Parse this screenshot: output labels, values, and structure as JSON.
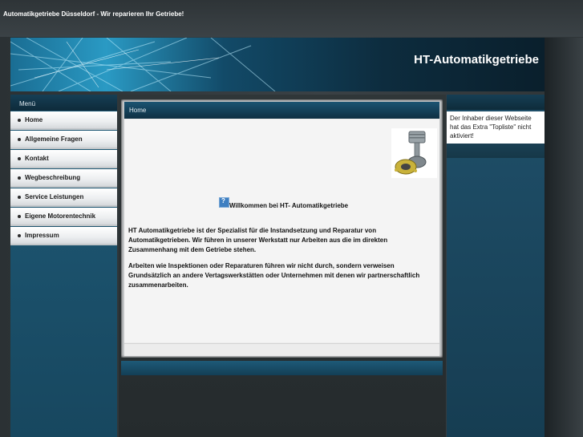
{
  "site": {
    "title": "Automatikgetriebe Düsseldorf - Wir reparieren Ihr Getriebe!"
  },
  "banner": {
    "title": "HT-Automatikgetriebe"
  },
  "menu": {
    "heading": "Menü",
    "items": [
      {
        "label": "Home"
      },
      {
        "label": "Allgemeine Fragen"
      },
      {
        "label": "Kontakt"
      },
      {
        "label": "Wegbeschreibung"
      },
      {
        "label": "Service Leistungen"
      },
      {
        "label": "Eigene Motorentechnik"
      },
      {
        "label": "Impressum"
      }
    ]
  },
  "content": {
    "heading": "Home",
    "welcome": "Willkommen bei HT- Automatikgetriebe",
    "paragraph1": [
      "HT Automatikgetriebe ist der Spezialist für die Instandsetzung und Reparatur von",
      "Automatikgetrieben. Wir führen in unserer Werkstatt nur Arbeiten aus die im direkten",
      "Zusammenhang mit dem Getriebe stehen."
    ],
    "paragraph2": [
      "Arbeiten wie Inspektionen oder Reparaturen führen wir nicht durch, sondern verweisen",
      "Grundsätzlich an andere Vertagswerkstätten oder Unternehmen mit denen wir partnerschaftlich",
      "zusammenarbeiten."
    ]
  },
  "sidebar_right": {
    "notice": "Der Inhaber dieser Webseite hat das Extra \"Topliste\" nicht aktiviert!"
  },
  "icons": {
    "broken_image": "broken-image-icon",
    "product_photo": "piston-photo"
  }
}
